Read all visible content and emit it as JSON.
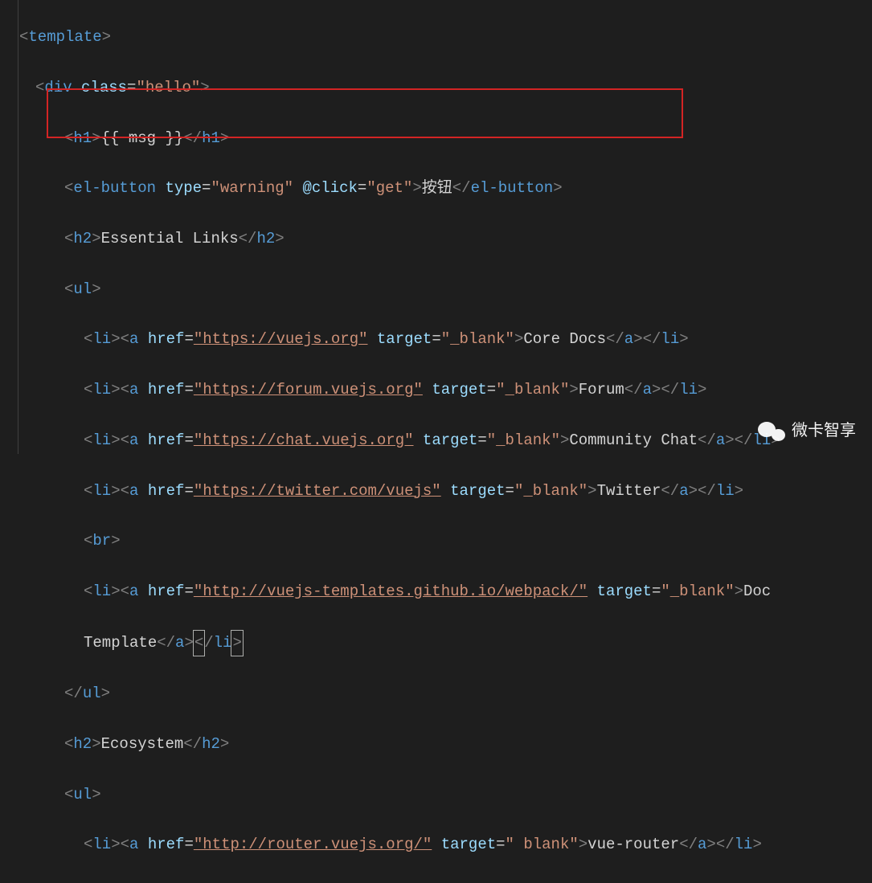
{
  "code": {
    "rootOpen": "template",
    "rootClose": "template",
    "divOpen": "div",
    "divClass_attr": "class",
    "divClass_val": "\"hello\"",
    "h1": "h1",
    "h1_expr": "{{ msg }}",
    "elbutton": "el-button",
    "elbutton_type_attr": "type",
    "elbutton_type_val": "\"warning\"",
    "elbutton_click_attr": "@click",
    "elbutton_click_val": "\"get\"",
    "elbutton_text": "按钮",
    "h2": "h2",
    "h2a_text": "Essential Links",
    "ul": "ul",
    "li": "li",
    "a": "a",
    "href_attr": "href",
    "target_attr": "target",
    "blank_val": "\"_blank\"",
    "blank_val2": "\" blank\"",
    "links": [
      {
        "href": "\"https://vuejs.org\"",
        "text": "Core Docs"
      },
      {
        "href": "\"https://forum.vuejs.org\"",
        "text": "Forum"
      },
      {
        "href": "\"https://chat.vuejs.org\"",
        "text": "Community Chat"
      },
      {
        "href": "\"https://twitter.com/vuejs\"",
        "text": "Twitter"
      }
    ],
    "br": "br",
    "webpack_href": "\"http://vuejs-templates.github.io/webpack/\"",
    "webpack_text": "Doc",
    "template_text": "Template",
    "h2b_text": "Ecosystem",
    "router_href": "\"http://router.vuejs.org/\"",
    "router_text": "vue-router"
  },
  "watermark": {
    "text": "微卡智享"
  }
}
